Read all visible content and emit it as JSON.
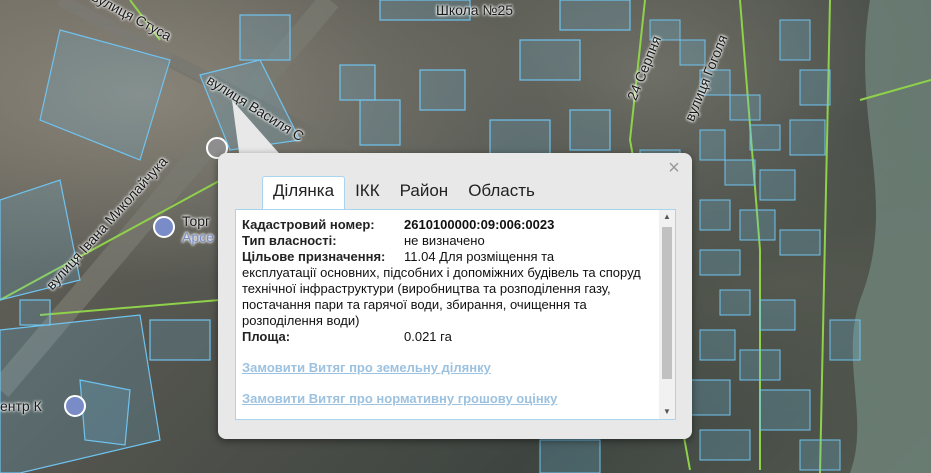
{
  "map": {
    "labels": {
      "street_stusa": "вулиця Стуса",
      "school": "Школа №25",
      "street_vasylia": "вулиця Василя С",
      "street_mykolaichuka": "вулиця Івана Миколайчука",
      "mall_name": "Торг",
      "mall_sub": "Арсе",
      "center": "ентр К",
      "street_serpnia": "24 Серпня",
      "street_pyrohova": "вулиця Гоголя"
    }
  },
  "popup": {
    "close_label": "×",
    "tabs": [
      "Ділянка",
      "ІКК",
      "Район",
      "Область"
    ],
    "fields": [
      {
        "label": "Кадастровий номер:",
        "value": "2610100000:09:006:0023"
      },
      {
        "label": "Тип власності:",
        "value": "не визначено"
      },
      {
        "label": "Цільове призначення:",
        "value": "11.04 Для розміщення та"
      },
      {
        "label": "",
        "value": "експлуатації основних, підсобних і допоміжних будівель та споруд технічної інфраструктури (виробництва та розподілення газу, постачання пари та гарячої води, збирання, очищення та розподілення води)"
      },
      {
        "label": "Площа:",
        "value": "0.021 га"
      }
    ],
    "links": {
      "land_extract": "Замовити Витяг про земельну ділянку",
      "valuation_extract": "Замовити Витяг про нормативну грошову оцінку"
    },
    "scroll_up": "▲",
    "scroll_down": "▼"
  }
}
